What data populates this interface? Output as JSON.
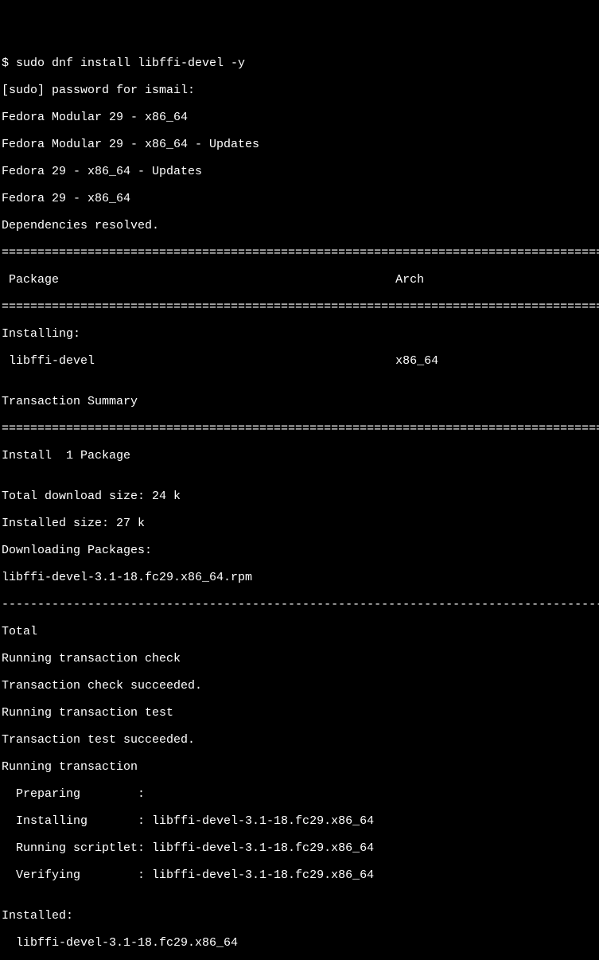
{
  "lines": {
    "cmd": "$ sudo dnf install libffi-devel -y",
    "pw": "[sudo] password for ismail:",
    "repo1": "Fedora Modular 29 - x86_64",
    "repo2": "Fedora Modular 29 - x86_64 - Updates",
    "repo3": "Fedora 29 - x86_64 - Updates",
    "repo4": "Fedora 29 - x86_64",
    "deps": "Dependencies resolved.",
    "sep_eq": "=======================================================================================",
    "hdr": " Package                                               Arch",
    "installing": "Installing:",
    "pkg": " libffi-devel                                          x86_64",
    "blank": "",
    "tsum": "Transaction Summary",
    "install1": "Install  1 Package",
    "dlsize": "Total download size: 24 k",
    "instsize": "Installed size: 27 k",
    "dlpkg": "Downloading Packages:",
    "rpm": "libffi-devel-3.1-18.fc29.x86_64.rpm",
    "sep_dash": "---------------------------------------------------------------------------------------",
    "total": "Total",
    "rtc": "Running transaction check",
    "tcs": "Transaction check succeeded.",
    "rtt": "Running transaction test",
    "tts": "Transaction test succeeded.",
    "rt": "Running transaction",
    "prep": "  Preparing        :",
    "inst": "  Installing       : libffi-devel-3.1-18.fc29.x86_64",
    "script": "  Running scriptlet: libffi-devel-3.1-18.fc29.x86_64",
    "verify": "  Verifying        : libffi-devel-3.1-18.fc29.x86_64",
    "installed": "Installed:",
    "instpkg": "  libffi-devel-3.1-18.fc29.x86_64"
  }
}
